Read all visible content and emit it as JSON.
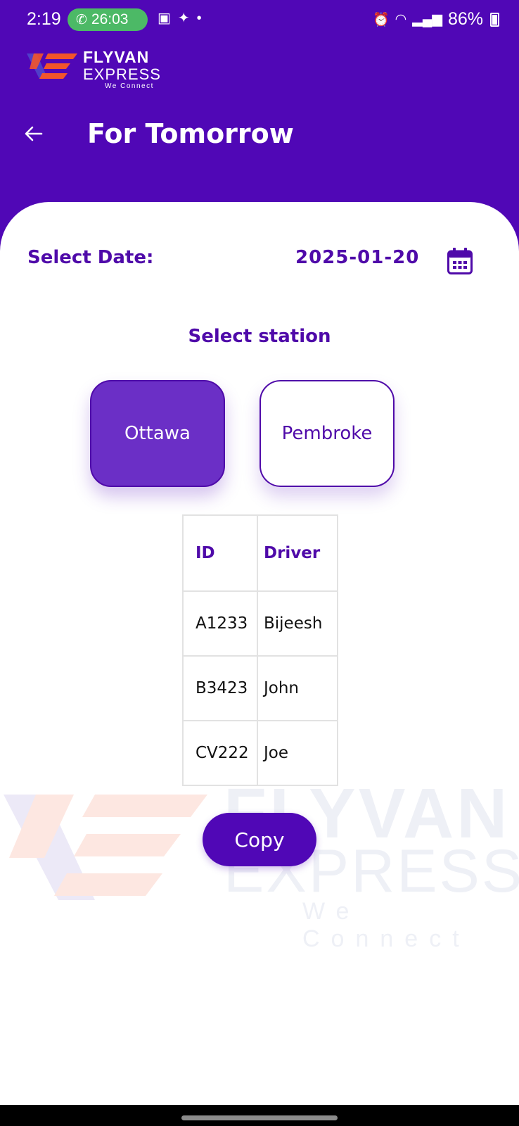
{
  "status_bar": {
    "time": "2:19",
    "call_duration": "26:03",
    "battery": "86%"
  },
  "brand": {
    "name": "FLYVAN",
    "sub": "EXPRESS",
    "tagline": "We Connect"
  },
  "header": {
    "title": "For Tomorrow"
  },
  "date_picker": {
    "label": "Select Date:",
    "value": "2025-01-20"
  },
  "stations": {
    "title": "Select station",
    "items": [
      {
        "label": "Ottawa",
        "selected": true
      },
      {
        "label": "Pembroke",
        "selected": false
      }
    ]
  },
  "table": {
    "headers": [
      "ID",
      "Driver"
    ],
    "rows": [
      [
        "A1233",
        "Bijeesh"
      ],
      [
        "B3423",
        "John"
      ],
      [
        "CV222",
        "Joe"
      ]
    ]
  },
  "actions": {
    "copy_label": "Copy"
  },
  "colors": {
    "primary": "#5007b6",
    "selected_station": "#6b2fc6",
    "logo_orange": "#f2552a"
  }
}
